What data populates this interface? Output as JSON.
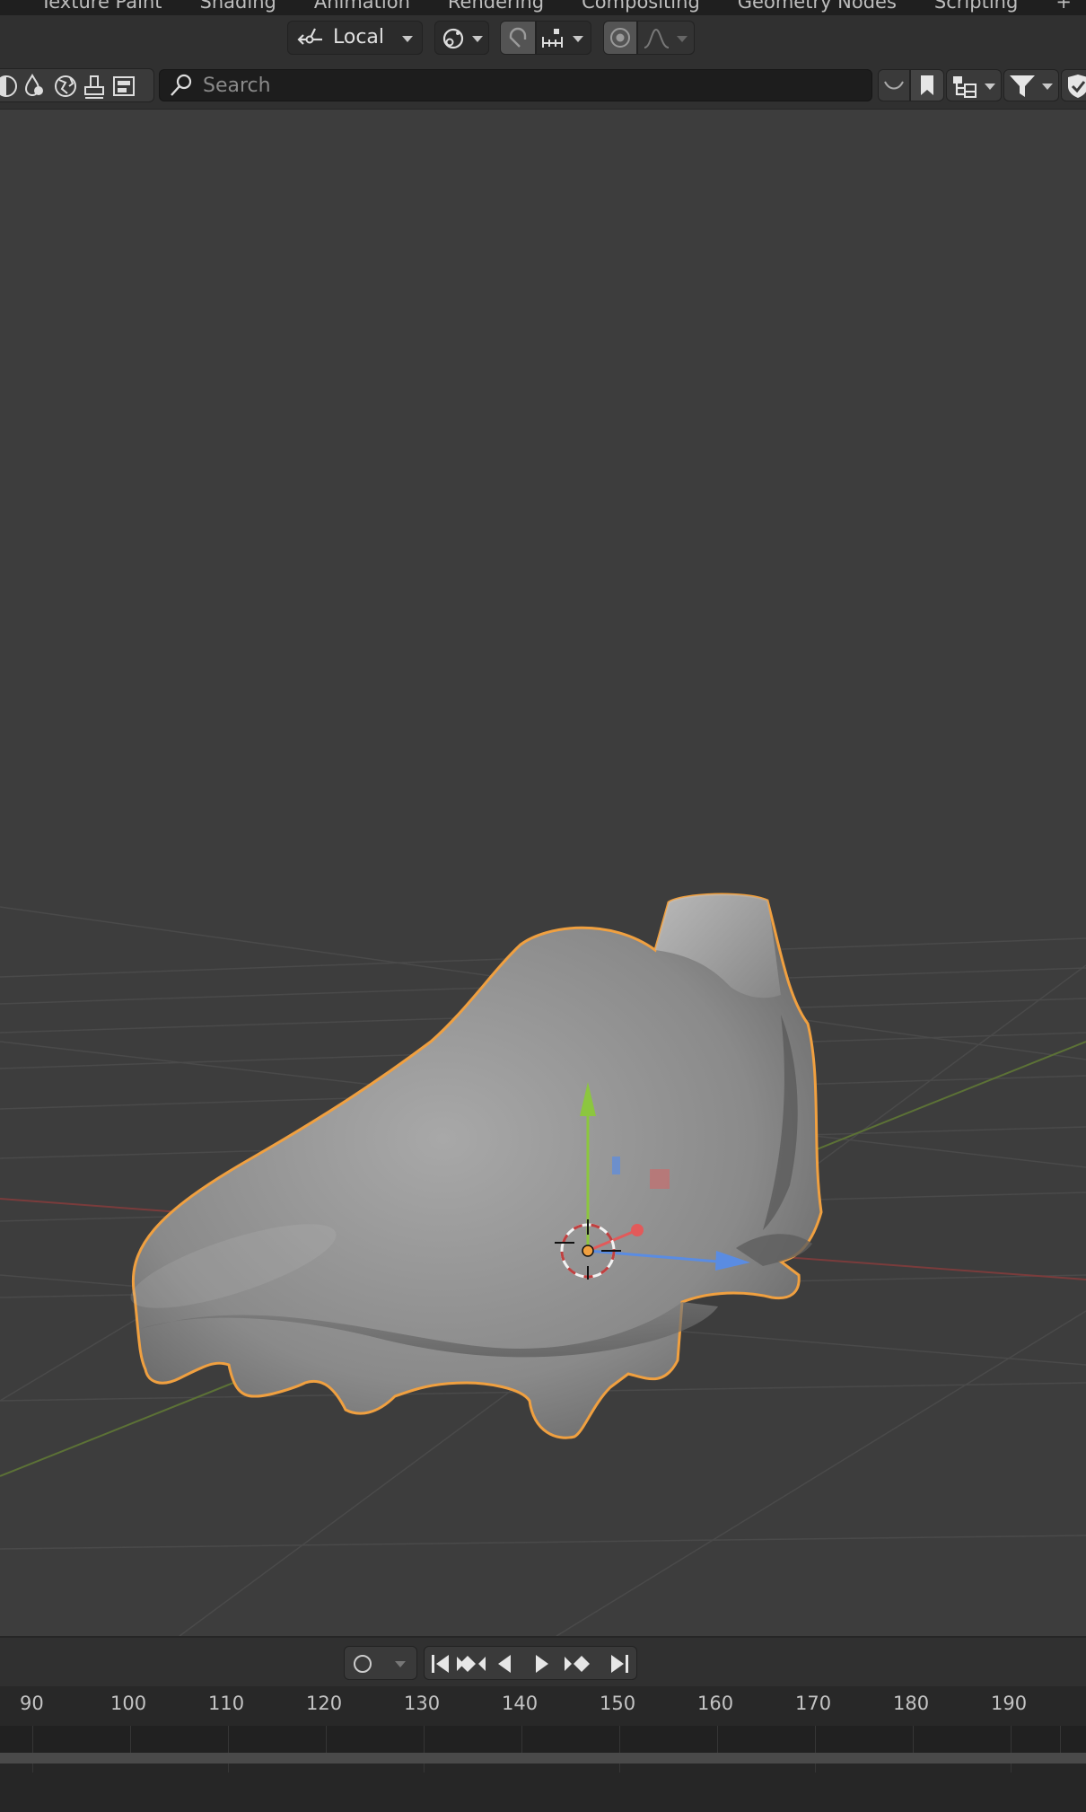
{
  "workspace_tabs": [
    "Texture Paint",
    "Shading",
    "Animation",
    "Rendering",
    "Compositing",
    "Geometry Nodes",
    "Scripting",
    "+"
  ],
  "toolbar": {
    "transform_orientation": "Local"
  },
  "outliner_header": {
    "search_placeholder": "Search"
  },
  "timeline": {
    "frame_labels": [
      "90",
      "100",
      "110",
      "120",
      "130",
      "140",
      "150",
      "160",
      "170",
      "180",
      "190"
    ]
  },
  "colors": {
    "selection_outline": "#f0a040",
    "axis_x": "#e25a5a",
    "axis_y": "#8cc63f",
    "axis_z": "#5a8ce2"
  }
}
